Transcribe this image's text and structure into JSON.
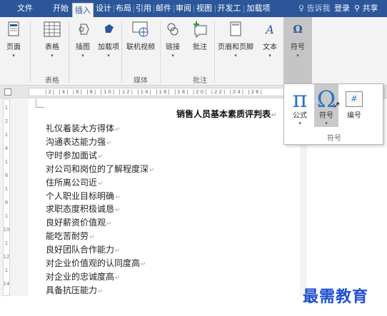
{
  "tabs": {
    "file": "文件",
    "home": "开始",
    "insert": "插入",
    "design": "设计",
    "layout": "布局",
    "references": "引用",
    "mailings": "邮件",
    "review": "审阅",
    "view": "视图",
    "developer": "开发工",
    "addins": "加载项",
    "tell_me": "告诉我",
    "login": "登录",
    "share": "共享"
  },
  "ribbon": {
    "pages": "页面",
    "table": "表格",
    "pictures": "插图",
    "addins": "加载项",
    "online_video": "联机视频",
    "link": "链接",
    "comment": "批注",
    "header_footer": "页眉和页脚",
    "text": "文本",
    "symbols": "符号",
    "group_table": "表格",
    "group_media": "媒体",
    "group_comments": "批注"
  },
  "ruler": {
    "ticks": "|2|  |4|  |6|  |8|  |10|  |12|  |14|  |16|  |18|  |20|  |22|  |24|  |26|"
  },
  "vruler_ticks": [
    "1",
    "2",
    "1",
    "4",
    "1",
    "6",
    "1",
    "8",
    "1",
    "10",
    "1",
    "12",
    "1",
    "14"
  ],
  "document": {
    "title": "销售人员基本素质评判表",
    "lines": [
      "礼仪着装大方得体",
      "沟通表达能力强",
      "守时参加面试",
      "对公司和岗位的了解程度深",
      "住所离公司近",
      "个人职业目标明确",
      "求职态度积极诚恳",
      "良好薪资价值观",
      "能吃苦耐劳",
      "良好团队合作能力",
      "对企业价值观的认同度高",
      "对企业的忠诚度高",
      "具备抗压能力"
    ],
    "paragraph_mark": "↵"
  },
  "symbols_panel": {
    "equation": "公式",
    "symbol": "符号",
    "number": "编号",
    "group_label": "符号",
    "pi_glyph": "π",
    "omega_glyph": "Ω",
    "number_glyph": "#"
  },
  "watermark": "最需教育",
  "colors": {
    "accent": "#2b579a",
    "symbol_blue": "#2b73c4"
  }
}
